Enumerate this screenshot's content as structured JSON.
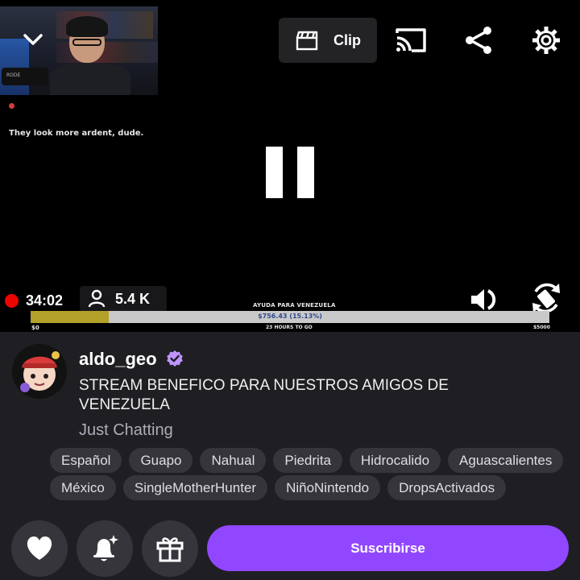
{
  "player": {
    "chat_overlay": "They look more ardent, dude.",
    "webcam_mic_label": "RODE",
    "clip_label": "Clip",
    "live_time": "34:02",
    "viewer_count": "5.4 K",
    "donation": {
      "title": "AYUDA PARA VENEZUELA",
      "amount": "$756.43 (15.13%)",
      "progress_fraction": 0.1513,
      "min_label": "$0",
      "time_left": "23 HOURS TO GO",
      "max_label": "$5000"
    },
    "icons": {
      "collapse": "chevron-down-icon",
      "clip": "clapperboard-icon",
      "cast": "cast-icon",
      "share": "share-icon",
      "settings": "gear-icon",
      "pause": "pause-icon",
      "live": "live-dot-icon",
      "viewers": "person-icon",
      "volume": "volume-icon",
      "rotate": "rotate-screen-icon"
    }
  },
  "channel": {
    "name": "aldo_geo",
    "title": "STREAM BENEFICO PARA NUESTROS AMIGOS DE VENEZUELA",
    "category": "Just Chatting",
    "tags_row1": [
      "Español",
      "Guapo",
      "Nahual",
      "Piedrita",
      "Hidrocalido",
      "Aguascalientes"
    ],
    "tags_row2": [
      "México",
      "SingleMotherHunter",
      "NiñoNintendo",
      "DropsActivados"
    ]
  },
  "actions": {
    "follow_icon": "heart-icon",
    "notify_icon": "bell-sparkle-icon",
    "gift_icon": "gift-icon",
    "subscribe_label": "Suscribirse"
  },
  "colors": {
    "accent": "#9147ff",
    "live": "#eb0400",
    "panel": "#1f1f23",
    "chip": "#35353b",
    "donation_fill": "#b3a129"
  }
}
